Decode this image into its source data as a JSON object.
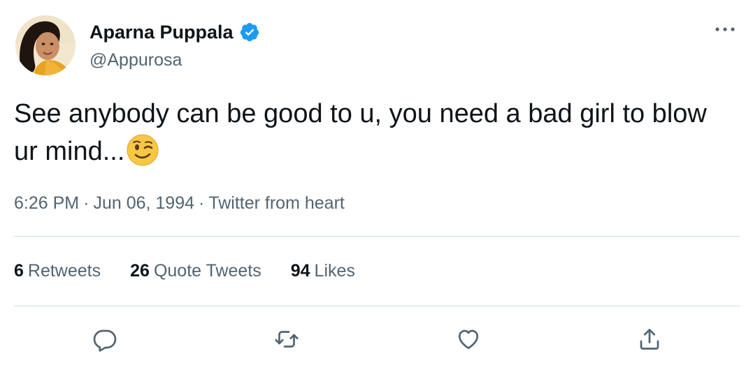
{
  "author": {
    "display_name": "Aparna Puppala",
    "handle": "@Appurosa",
    "verified": true,
    "verified_color": "#1d9bf0"
  },
  "tweet": {
    "text": "See anybody can be good to u, you need a bad girl to blow ur mind...",
    "emoji": "winking-face",
    "time": "6:26 PM",
    "separator": "·",
    "date": "Jun 06, 1994",
    "source": "Twitter from heart"
  },
  "stats": {
    "retweets_count": "6",
    "retweets_label": "Retweets",
    "quote_count": "26",
    "quote_label": "Quote Tweets",
    "likes_count": "94",
    "likes_label": "Likes"
  },
  "actions": {
    "reply_icon": "reply-icon",
    "retweet_icon": "retweet-icon",
    "like_icon": "heart-icon",
    "share_icon": "share-icon",
    "icon_color": "#536471"
  },
  "colors": {
    "text_primary": "#0f1419",
    "text_secondary": "#536471",
    "divider": "#cfd9de"
  }
}
